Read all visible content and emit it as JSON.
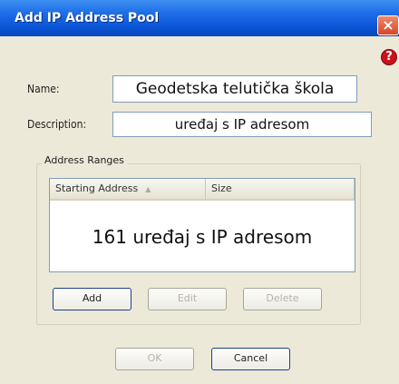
{
  "dialog": {
    "title": "Add IP Address Pool",
    "close_glyph": "×",
    "help_glyph": "?"
  },
  "form": {
    "name_label": "Name:",
    "name_value": "Geodetska telutička škola",
    "description_label": "Description:",
    "description_value": "uređaj s IP adresom"
  },
  "address_ranges": {
    "group_label": "Address Ranges",
    "columns": [
      "Starting Address",
      "Size"
    ],
    "sort_glyph": "▲",
    "body_text": "161 uređaj s IP adresom"
  },
  "range_buttons": {
    "add": "Add",
    "edit": "Edit",
    "delete": "Delete"
  },
  "dialog_buttons": {
    "ok": "OK",
    "cancel": "Cancel"
  }
}
